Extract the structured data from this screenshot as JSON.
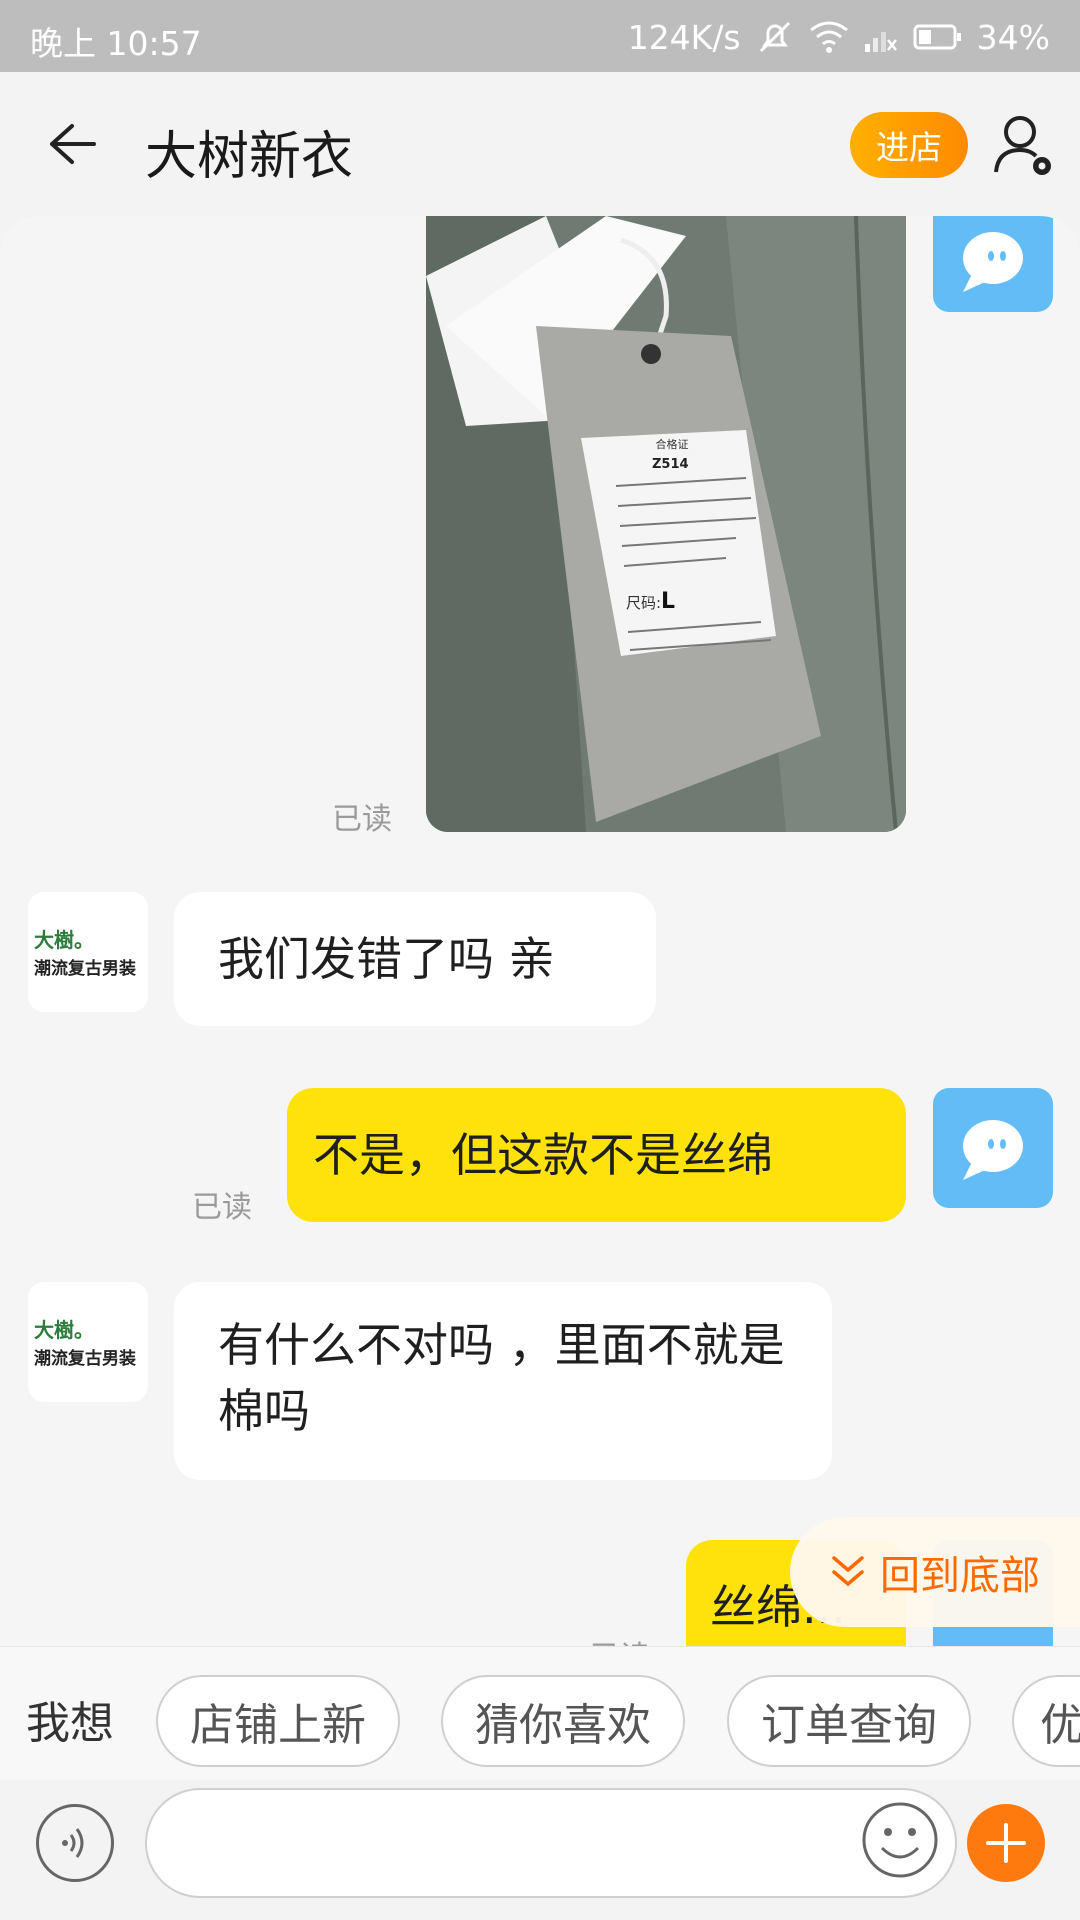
{
  "status_bar": {
    "time": "晚上 10:57",
    "net_speed": "124K/s",
    "battery": "34%"
  },
  "header": {
    "title": "大树新衣",
    "enter_shop": "进店"
  },
  "shop_avatar": {
    "line1": "大樹。",
    "line2": "潮流复古男装"
  },
  "messages": {
    "image_read": "已读",
    "m1_text": "我们发错了吗  亲",
    "m2_text": "不是，但这款不是丝绵",
    "m2_read": "已读",
    "m3_text": "有什么不对吗 ，里面不就是棉吗",
    "m4_text": "丝绵...",
    "m4_read": "已读"
  },
  "photo_tag": {
    "title": "合格证",
    "product_code": "Z514",
    "size_label": "尺码:",
    "size": "L"
  },
  "back_to_bottom": "回到底部",
  "quick_replies": {
    "label": "我想",
    "chips": [
      "店铺上新",
      "猜你喜欢",
      "订单查询",
      "优"
    ]
  },
  "colors": {
    "self_bubble": "#ffe20a",
    "accent_orange": "#ff7a0e",
    "self_avatar": "#62bdf7"
  }
}
